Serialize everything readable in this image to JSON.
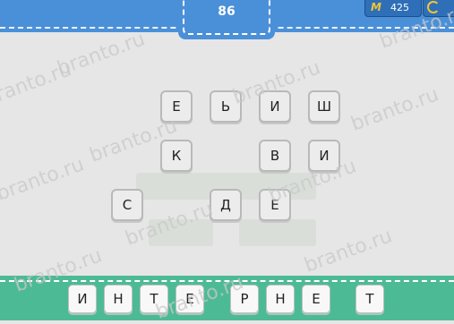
{
  "header": {
    "level": "86",
    "coins": "425",
    "coin_symbol": "M"
  },
  "board": {
    "letters": [
      "Е",
      "Ь",
      "И",
      "Ш",
      "К",
      "В",
      "И",
      "С",
      "Д",
      "Е"
    ]
  },
  "answer": {
    "letters": [
      "И",
      "Н",
      "Т",
      "Е",
      "Р",
      "Н",
      "Е",
      "Т"
    ]
  },
  "watermark": {
    "text": "branto.ru"
  },
  "colors": {
    "header": "#4a90d9",
    "footer": "#4dba96",
    "background": "#e6e6e6",
    "coin": "#f4c430"
  }
}
